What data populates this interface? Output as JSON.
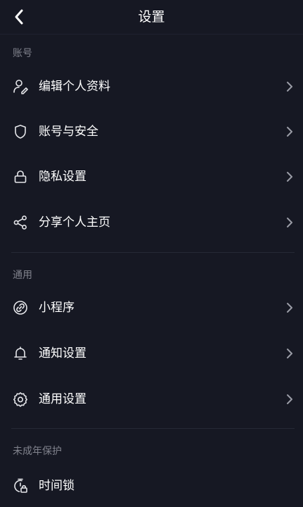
{
  "header": {
    "title": "设置",
    "back_icon": "chevron-left-icon"
  },
  "sections": [
    {
      "label": "账号",
      "items": [
        {
          "label": "编辑个人资料",
          "icon": "user-edit-icon"
        },
        {
          "label": "账号与安全",
          "icon": "shield-icon"
        },
        {
          "label": "隐私设置",
          "icon": "lock-icon"
        },
        {
          "label": "分享个人主页",
          "icon": "share-icon"
        }
      ]
    },
    {
      "label": "通用",
      "items": [
        {
          "label": "小程序",
          "icon": "link-icon"
        },
        {
          "label": "通知设置",
          "icon": "bell-icon"
        },
        {
          "label": "通用设置",
          "icon": "gear-icon"
        }
      ]
    },
    {
      "label": "未成年保护",
      "items": [
        {
          "label": "时间锁",
          "icon": "time-lock-icon"
        }
      ]
    }
  ],
  "colors": {
    "background": "#161823",
    "text_primary": "#ffffff",
    "text_secondary": "#80828c",
    "icon": "#e5e6ea",
    "chevron": "#9a9ca6",
    "divider": "#262936"
  }
}
